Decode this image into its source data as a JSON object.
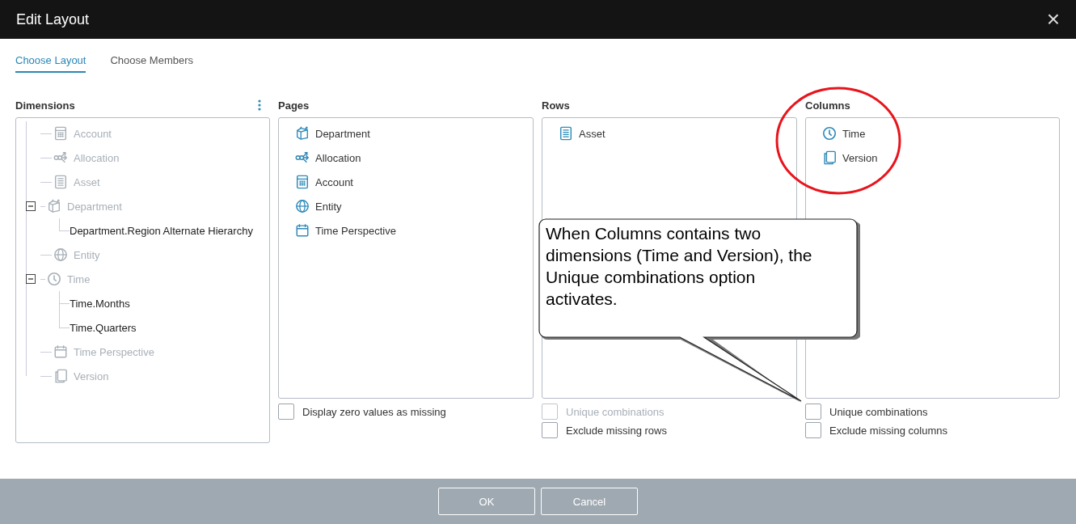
{
  "window": {
    "title": "Edit Layout",
    "close": "×"
  },
  "tabs": [
    {
      "label": "Choose Layout",
      "selected": true
    },
    {
      "label": "Choose Members",
      "selected": false
    }
  ],
  "dimensions": {
    "title": "Dimensions",
    "items": [
      {
        "label": "Account",
        "kind": "calculator",
        "disabled": true
      },
      {
        "label": "Allocation",
        "kind": "share",
        "disabled": true
      },
      {
        "label": "Asset",
        "kind": "list",
        "disabled": true
      },
      {
        "label": "Department",
        "kind": "box",
        "disabled": true,
        "expanded": true,
        "children": [
          {
            "label": "Department.Region Alternate Hierarchy",
            "disabled": false
          }
        ]
      },
      {
        "label": "Entity",
        "kind": "globe",
        "disabled": true
      },
      {
        "label": "Time",
        "kind": "clock",
        "disabled": true,
        "expanded": true,
        "children": [
          {
            "label": "Time.Months",
            "disabled": false
          },
          {
            "label": "Time.Quarters",
            "disabled": false
          }
        ]
      },
      {
        "label": "Time Perspective",
        "kind": "calendar",
        "disabled": true
      },
      {
        "label": "Version",
        "kind": "copy",
        "disabled": true
      }
    ]
  },
  "panels": [
    {
      "title": "Pages",
      "items": [
        {
          "label": "Department",
          "kind": "box"
        },
        {
          "label": "Allocation",
          "kind": "share"
        },
        {
          "label": "Account",
          "kind": "calculator"
        },
        {
          "label": "Entity",
          "kind": "globe"
        },
        {
          "label": "Time Perspective",
          "kind": "calendar"
        }
      ],
      "options": [
        {
          "label": "Display zero values as missing",
          "checked": false,
          "disabled": false
        }
      ]
    },
    {
      "title": "Rows",
      "items": [
        {
          "label": "Asset",
          "kind": "list"
        }
      ],
      "options": [
        {
          "label": "Unique combinations",
          "checked": false,
          "disabled": true
        },
        {
          "label": "Exclude missing rows",
          "checked": false,
          "disabled": false
        }
      ]
    },
    {
      "title": "Columns",
      "items": [
        {
          "label": "Time",
          "kind": "clock"
        },
        {
          "label": "Version",
          "kind": "copy"
        }
      ],
      "options": [
        {
          "label": "Unique combinations",
          "checked": false,
          "disabled": false
        },
        {
          "label": "Exclude missing columns",
          "checked": false,
          "disabled": false
        }
      ]
    }
  ],
  "callout": {
    "text": "When Columns contains two dimensions (Time and Version), the Unique combinations option activates."
  },
  "buttons": [
    {
      "label": "OK"
    },
    {
      "label": "Cancel"
    }
  ]
}
